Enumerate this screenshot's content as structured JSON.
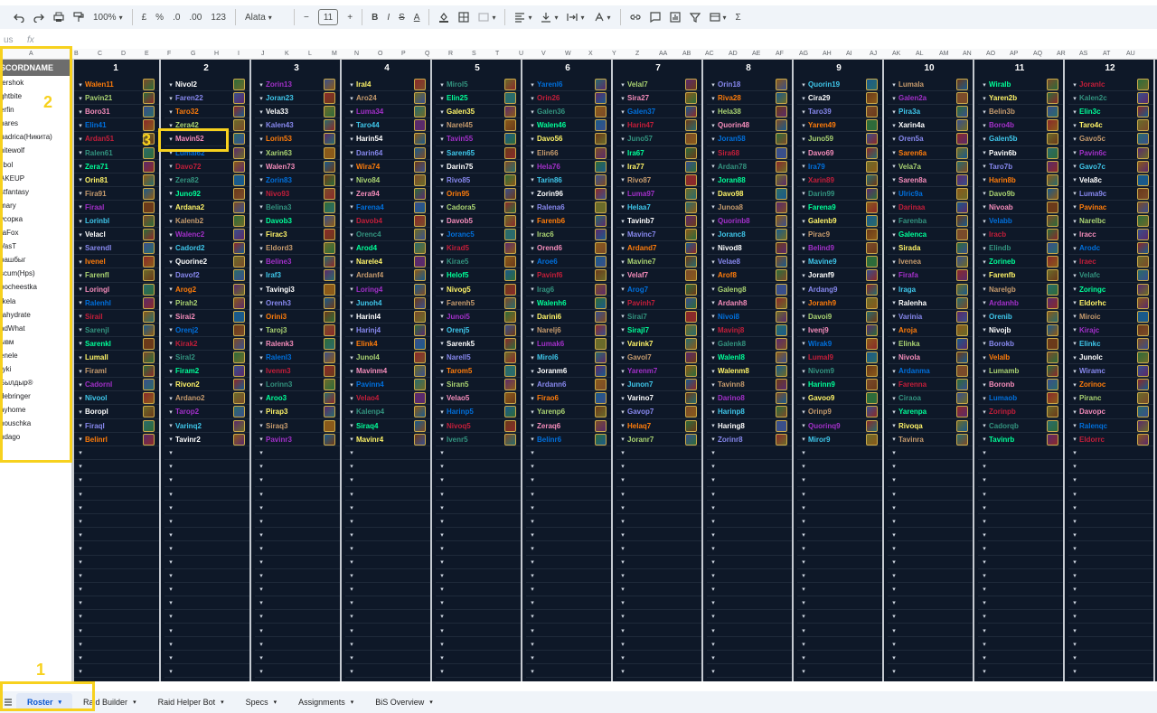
{
  "toolbar": {
    "zoom": "100%",
    "currency": "£",
    "percent": "%",
    "dec_decrease": ".0",
    "dec_increase": ".00",
    "format": "123",
    "font": "Alata",
    "font_size": "11",
    "minus": "−",
    "plus": "+",
    "bold": "B",
    "italic": "I",
    "strike": "S",
    "text_color": "A",
    "sigma": "Σ"
  },
  "formula": {
    "label": "fx",
    "cell_ref": "us"
  },
  "left_header": "SCORDNAME",
  "left_names": [
    "tershok",
    "ghtbite",
    "erfin",
    "nares",
    "uadrica(Никита)",
    "hitewolf",
    "ilbol",
    "AKEUP",
    "stfantasy",
    "mary",
    "усорка",
    "raFox",
    "VasT",
    "рашбыг",
    "scum(Hps)",
    "bocheestka",
    "rkela",
    "rahydrate",
    "adWhat",
    "ывм",
    "enele",
    "ryki",
    "Былдыр®",
    "debringer",
    "ayhome",
    "nouschka",
    "ndago"
  ],
  "column_letters": [
    "A",
    "B",
    "C",
    "D",
    "E",
    "F",
    "G",
    "H",
    "I",
    "J",
    "K",
    "L",
    "M",
    "N",
    "O",
    "P",
    "Q",
    "R",
    "S",
    "T",
    "U",
    "V",
    "W",
    "X",
    "Y",
    "Z",
    "AA",
    "AB",
    "AC",
    "AD",
    "AE",
    "AF",
    "AG",
    "AH",
    "AI",
    "AJ",
    "AK",
    "AL",
    "AM",
    "AN",
    "AO",
    "AP",
    "AQ",
    "AR",
    "AS",
    "AT",
    "AU"
  ],
  "groups": [
    {
      "num": "1",
      "names": [
        "Walen11",
        "Pavin21",
        "Boro31",
        "Elin41",
        "Ardan51",
        "Ralen61",
        "Zera71",
        "Orin81",
        "Fira91",
        "Firaal",
        "Lorinbl",
        "Velacl",
        "Sarendl",
        "Ivenel",
        "Farenfl",
        "Loringl",
        "Ralenhl",
        "Sirail",
        "Sarenjl",
        "Sarenkl",
        "Lumall",
        "Firaml",
        "Cadornl",
        "Nivool",
        "Boropl",
        "Firaql",
        "Belinrl"
      ]
    },
    {
      "num": "2",
      "names": [
        "Nivol2",
        "Faren22",
        "Taro32",
        "Zera42",
        "Mavin52",
        "Lumal62",
        "Davo72",
        "Zera82",
        "Juno92",
        "Ardana2",
        "Kalenb2",
        "Walenc2",
        "Cadord2",
        "Quorine2",
        "Davof2",
        "Arog2",
        "Pirah2",
        "Sirai2",
        "Orenj2",
        "Kirak2",
        "Siral2",
        "Firam2",
        "Rivon2",
        "Ardano2",
        "Tarop2",
        "Varinq2",
        "Tavinr2"
      ]
    },
    {
      "num": "3",
      "names": [
        "Zorin13",
        "Joran23",
        "Vela33",
        "Kalen43",
        "Lorin53",
        "Xarin63",
        "Walen73",
        "Zorin83",
        "Nivo93",
        "Belina3",
        "Davob3",
        "Firac3",
        "Eldord3",
        "Beline3",
        "Iraf3",
        "Tavingi3",
        "Orenh3",
        "Orini3",
        "Taroj3",
        "Ralenk3",
        "Ralenl3",
        "Ivenm3",
        "Lorinn3",
        "Aroo3",
        "Pirap3",
        "Siraq3",
        "Pavinr3"
      ]
    },
    {
      "num": "4",
      "names": [
        "Iral4",
        "Aro24",
        "Luma34",
        "Taro44",
        "Harin54",
        "Darin64",
        "Wira74",
        "Nivo84",
        "Zera94",
        "Farena4",
        "Davob4",
        "Orenc4",
        "Arod4",
        "Narele4",
        "Ardanf4",
        "Loring4",
        "Junoh4",
        "Harinl4",
        "Harinj4",
        "Elink4",
        "Junol4",
        "Mavinm4",
        "Pavinn4",
        "Velao4",
        "Kalenp4",
        "Siraq4",
        "Mavinr4"
      ]
    },
    {
      "num": "5",
      "names": [
        "Mirol5",
        "Elin25",
        "Galen35",
        "Narel45",
        "Tavin55",
        "Saren65",
        "Darin75",
        "Rivo85",
        "Orin95",
        "Cadora5",
        "Davob5",
        "Joranc5",
        "Kirad5",
        "Kirae5",
        "Helof5",
        "Nivog5",
        "Farenh5",
        "Junoi5",
        "Orenj5",
        "Sarenk5",
        "Narell5",
        "Tarom5",
        "Siran5",
        "Velao5",
        "Harinp5",
        "Nivoq5",
        "Ivenr5"
      ]
    },
    {
      "num": "6",
      "names": [
        "Yarenl6",
        "Orin26",
        "Galen36",
        "Walen46",
        "Davo56",
        "Elin66",
        "Hela76",
        "Tarin86",
        "Zorin96",
        "Ralena6",
        "Farenb6",
        "Irac6",
        "Orend6",
        "Aroe6",
        "Pavinf6",
        "Irag6",
        "Walenh6",
        "Darini6",
        "Narelj6",
        "Lumak6",
        "Mirol6",
        "Joranm6",
        "Ardann6",
        "Firao6",
        "Yarenp6",
        "Zeraq6",
        "Belinr6"
      ]
    },
    {
      "num": "7",
      "names": [
        "Velal7",
        "Sira27",
        "Galen37",
        "Harin47",
        "Juno57",
        "Ira67",
        "Ira77",
        "Rivo87",
        "Luma97",
        "Helaa7",
        "Tavinb7",
        "Mavinc7",
        "Ardand7",
        "Mavine7",
        "Velaf7",
        "Arog7",
        "Pavinh7",
        "Sirai7",
        "Sirajl7",
        "Varink7",
        "Gavol7",
        "Yarenm7",
        "Junon7",
        "Varino7",
        "Gavop7",
        "Helaq7",
        "Joranr7"
      ]
    },
    {
      "num": "8",
      "names": [
        "Orin18",
        "Riva28",
        "Hela38",
        "Quorin48",
        "Joran58",
        "Sira68",
        "Ardan78",
        "Joran88",
        "Davo98",
        "Junoa8",
        "Quorinb8",
        "Joranc8",
        "Nivod8",
        "Velae8",
        "Arof8",
        "Galeng8",
        "Ardanh8",
        "Nivoi8",
        "Mavinj8",
        "Galenk8",
        "Walenl8",
        "Walenm8",
        "Tavinn8",
        "Darino8",
        "Harinp8",
        "Haring8",
        "Zorinr8"
      ]
    },
    {
      "num": "9",
      "names": [
        "Quorin19",
        "Cira29",
        "Taro39",
        "Yaren49",
        "Juno59",
        "Davo69",
        "Ira79",
        "Xarin89",
        "Darin99",
        "Farena9",
        "Galenb9",
        "Pirac9",
        "Belind9",
        "Mavine9",
        "Joranf9",
        "Ardang9",
        "Joranh9",
        "Davoi9",
        "Ivenj9",
        "Wirak9",
        "Lumal9",
        "Nivom9",
        "Harinn9",
        "Gavoo9",
        "Orinp9",
        "Quorinq9",
        "Miror9"
      ]
    },
    {
      "num": "10",
      "names": [
        "Lumala",
        "Galen2a",
        "Pira3a",
        "Xarin4a",
        "Oren5a",
        "Saren6a",
        "Vela7a",
        "Saren8a",
        "Ulric9a",
        "Darinaa",
        "Farenba",
        "Galenca",
        "Sirada",
        "Ivenea",
        "Firafa",
        "Iraga",
        "Ralenha",
        "Varinia",
        "Arojа",
        "Elinka",
        "Nivola",
        "Ardanma",
        "Farenna",
        "Ciraoa",
        "Yarenpa",
        "Rivoqa",
        "Tavinra"
      ]
    },
    {
      "num": "11",
      "names": [
        "Wiralb",
        "Yaren2b",
        "Belin3b",
        "Boro4b",
        "Galen5b",
        "Pavin6b",
        "Taro7b",
        "Harin8b",
        "Davo9b",
        "Nivoab",
        "Velabb",
        "Iracb",
        "Elindb",
        "Zorineb",
        "Farenfb",
        "Narelgb",
        "Ardanhb",
        "Orenib",
        "Nivojb",
        "Borokb",
        "Velalb",
        "Lumamb",
        "Boronb",
        "Lumaob",
        "Zorinpb",
        "Cadorqb",
        "Tavinrb"
      ]
    },
    {
      "num": "12",
      "names": [
        "Joranlc",
        "Kalen2c",
        "Elin3c",
        "Taro4c",
        "Gavo5c",
        "Pavin6c",
        "Gavo7c",
        "Vela8c",
        "Luma9c",
        "Pavinac",
        "Narelbc",
        "Iracc",
        "Arodc",
        "Iraec",
        "Velafc",
        "Zoringc",
        "Eldorhc",
        "Miroic",
        "Kirajc",
        "Elinkc",
        "Junolc",
        "Wiramc",
        "Zorinoc",
        "Piranc",
        "Davopc",
        "Ralenqc",
        "Eldorrc"
      ]
    }
  ],
  "tabs": [
    "Roster",
    "Raid Builder",
    "Raid Helper Bot",
    "Specs",
    "Assignments",
    "BiS Overview"
  ],
  "active_tab": "Roster",
  "highlights": [
    "1",
    "2",
    "3"
  ],
  "colors": {
    "sheet_bg": "#0e1828",
    "highlight": "#f7d11e",
    "active_tab": "#0b57d0"
  }
}
